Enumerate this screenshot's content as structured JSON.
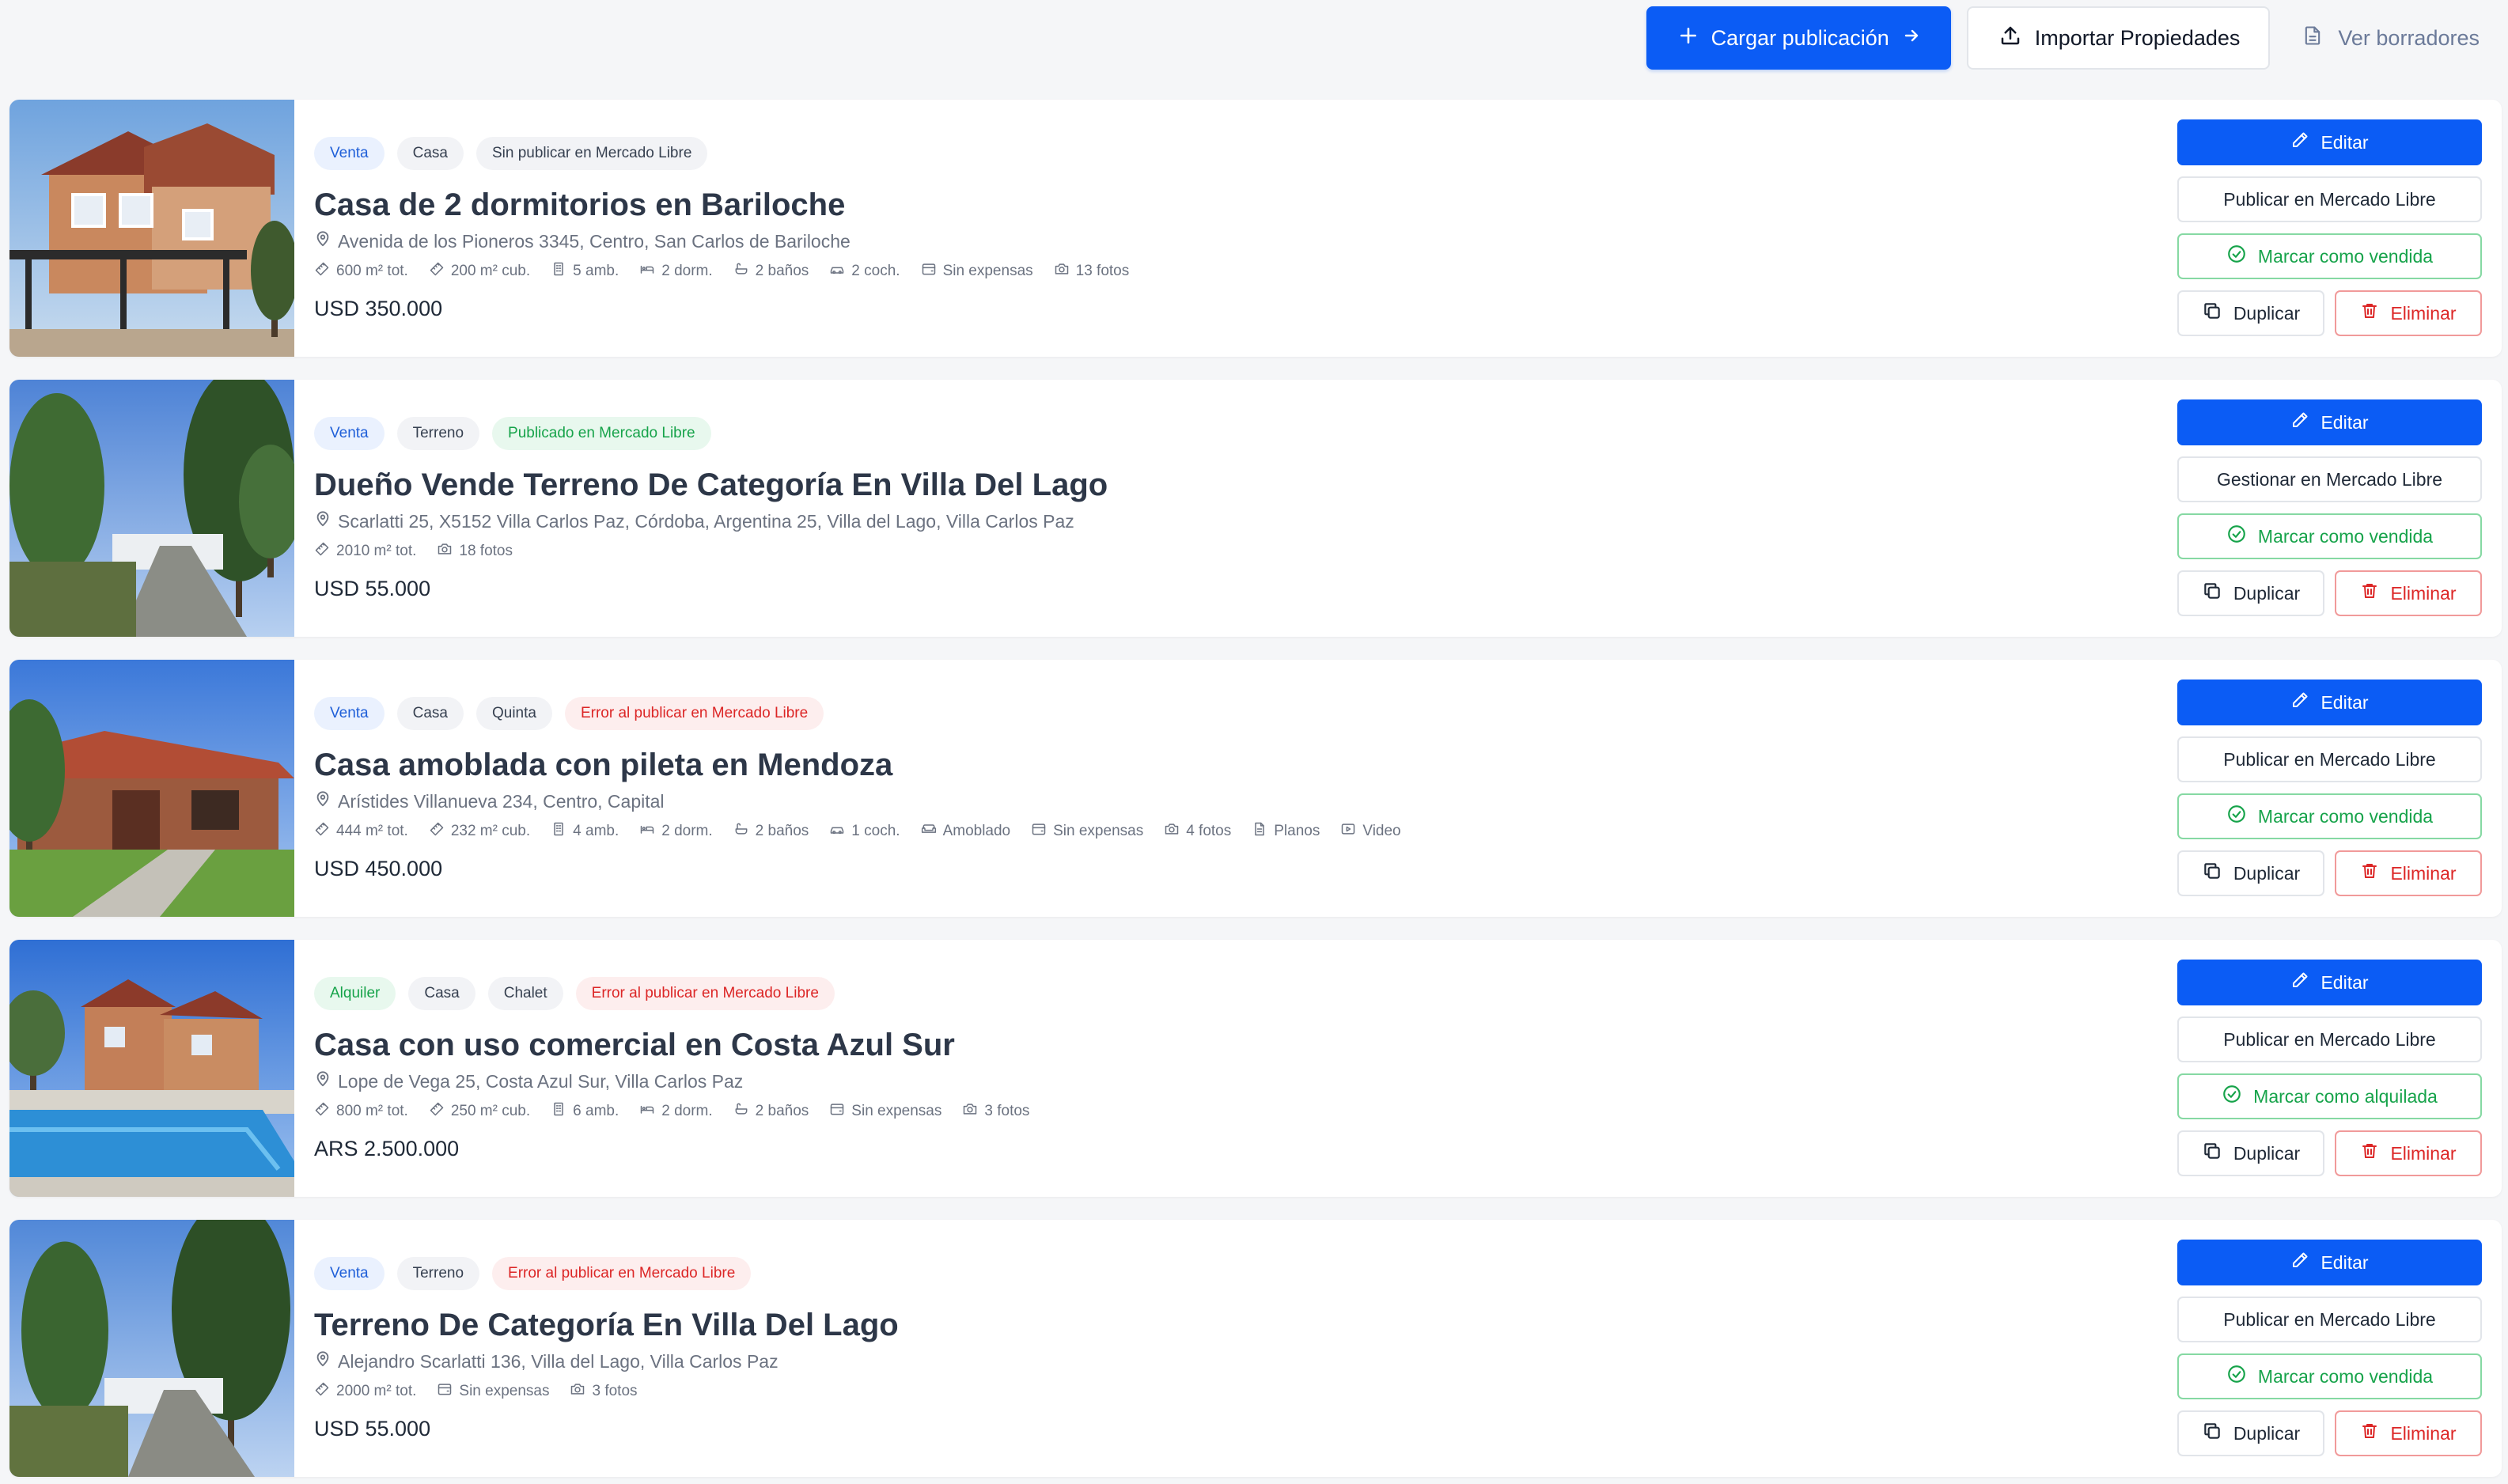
{
  "toolbar": {
    "new_label": "Cargar publicación",
    "import_label": "Importar Propiedades",
    "drafts_label": "Ver borradores"
  },
  "colors": {
    "primary": "#0b5cf5",
    "success": "#16a34a",
    "danger": "#dc2626",
    "background": "#f5f6f8"
  },
  "listings": [
    {
      "badges": [
        {
          "text": "Venta",
          "kind": "op-venta"
        },
        {
          "text": "Casa",
          "kind": "type"
        },
        {
          "text": "Sin publicar en Mercado Libre",
          "kind": "st-none"
        }
      ],
      "title": "Casa de 2 dormitorios en Bariloche",
      "address": "Avenida de los Pioneros 3345, Centro, San Carlos de Bariloche",
      "features": [
        {
          "icon": "ruler-icon",
          "text": "600 m² tot."
        },
        {
          "icon": "ruler-icon",
          "text": "200 m² cub."
        },
        {
          "icon": "building-icon",
          "text": "5 amb."
        },
        {
          "icon": "bed-icon",
          "text": "2 dorm."
        },
        {
          "icon": "bath-icon",
          "text": "2 baños"
        },
        {
          "icon": "car-icon",
          "text": "2 coch."
        },
        {
          "icon": "wallet-icon",
          "text": "Sin expensas"
        },
        {
          "icon": "camera-icon",
          "text": "13 fotos"
        }
      ],
      "price": "USD 350.000",
      "actions": {
        "edit": "Editar",
        "ml": "Publicar en Mercado Libre",
        "mark": "Marcar como vendida",
        "duplicate": "Duplicar",
        "delete": "Eliminar"
      }
    },
    {
      "badges": [
        {
          "text": "Venta",
          "kind": "op-venta"
        },
        {
          "text": "Terreno",
          "kind": "type"
        },
        {
          "text": "Publicado en Mercado Libre",
          "kind": "st-pub"
        }
      ],
      "title": "Dueño Vende Terreno De Categoría En Villa Del Lago",
      "address": "Scarlatti 25, X5152 Villa Carlos Paz, Córdoba, Argentina 25, Villa del Lago, Villa Carlos Paz",
      "features": [
        {
          "icon": "ruler-icon",
          "text": "2010 m² tot."
        },
        {
          "icon": "camera-icon",
          "text": "18 fotos"
        }
      ],
      "price": "USD 55.000",
      "actions": {
        "edit": "Editar",
        "ml": "Gestionar en Mercado Libre",
        "mark": "Marcar como vendida",
        "duplicate": "Duplicar",
        "delete": "Eliminar"
      }
    },
    {
      "badges": [
        {
          "text": "Venta",
          "kind": "op-venta"
        },
        {
          "text": "Casa",
          "kind": "type"
        },
        {
          "text": "Quinta",
          "kind": "type"
        },
        {
          "text": "Error al publicar en Mercado Libre",
          "kind": "st-err"
        }
      ],
      "title": "Casa amoblada con pileta en Mendoza",
      "address": "Arístides Villanueva 234, Centro, Capital",
      "features": [
        {
          "icon": "ruler-icon",
          "text": "444 m² tot."
        },
        {
          "icon": "ruler-icon",
          "text": "232 m² cub."
        },
        {
          "icon": "building-icon",
          "text": "4 amb."
        },
        {
          "icon": "bed-icon",
          "text": "2 dorm."
        },
        {
          "icon": "bath-icon",
          "text": "2 baños"
        },
        {
          "icon": "car-icon",
          "text": "1 coch."
        },
        {
          "icon": "sofa-icon",
          "text": "Amoblado"
        },
        {
          "icon": "wallet-icon",
          "text": "Sin expensas"
        },
        {
          "icon": "camera-icon",
          "text": "4 fotos"
        },
        {
          "icon": "file-icon",
          "text": "Planos"
        },
        {
          "icon": "video-icon",
          "text": "Video"
        }
      ],
      "price": "USD 450.000",
      "actions": {
        "edit": "Editar",
        "ml": "Publicar en Mercado Libre",
        "mark": "Marcar como vendida",
        "duplicate": "Duplicar",
        "delete": "Eliminar"
      }
    },
    {
      "badges": [
        {
          "text": "Alquiler",
          "kind": "op-alquiler"
        },
        {
          "text": "Casa",
          "kind": "type"
        },
        {
          "text": "Chalet",
          "kind": "type"
        },
        {
          "text": "Error al publicar en Mercado Libre",
          "kind": "st-err"
        }
      ],
      "title": "Casa con uso comercial en Costa Azul Sur",
      "address": "Lope de Vega 25, Costa Azul Sur, Villa Carlos Paz",
      "features": [
        {
          "icon": "ruler-icon",
          "text": "800 m² tot."
        },
        {
          "icon": "ruler-icon",
          "text": "250 m² cub."
        },
        {
          "icon": "building-icon",
          "text": "6 amb."
        },
        {
          "icon": "bed-icon",
          "text": "2 dorm."
        },
        {
          "icon": "bath-icon",
          "text": "2 baños"
        },
        {
          "icon": "wallet-icon",
          "text": "Sin expensas"
        },
        {
          "icon": "camera-icon",
          "text": "3 fotos"
        }
      ],
      "price": "ARS 2.500.000",
      "actions": {
        "edit": "Editar",
        "ml": "Publicar en Mercado Libre",
        "mark": "Marcar como alquilada",
        "duplicate": "Duplicar",
        "delete": "Eliminar"
      }
    },
    {
      "badges": [
        {
          "text": "Venta",
          "kind": "op-venta"
        },
        {
          "text": "Terreno",
          "kind": "type"
        },
        {
          "text": "Error al publicar en Mercado Libre",
          "kind": "st-err"
        }
      ],
      "title": "Terreno De Categoría En Villa Del Lago",
      "address": "Alejandro Scarlatti 136, Villa del Lago, Villa Carlos Paz",
      "features": [
        {
          "icon": "ruler-icon",
          "text": "2000 m² tot."
        },
        {
          "icon": "wallet-icon",
          "text": "Sin expensas"
        },
        {
          "icon": "camera-icon",
          "text": "3 fotos"
        }
      ],
      "price": "USD 55.000",
      "actions": {
        "edit": "Editar",
        "ml": "Publicar en Mercado Libre",
        "mark": "Marcar como vendida",
        "duplicate": "Duplicar",
        "delete": "Eliminar"
      }
    }
  ]
}
